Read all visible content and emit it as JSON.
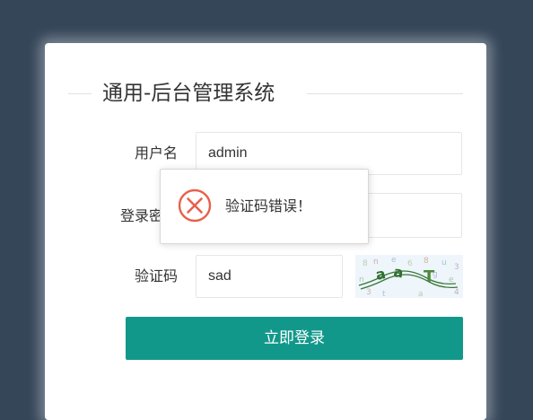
{
  "app": {
    "title": "通用-后台管理系统"
  },
  "form": {
    "username_label": "用户名",
    "username_value": "admin",
    "password_label": "登录密码",
    "password_value": "",
    "captcha_label": "验证码",
    "captcha_value": "sad",
    "submit_label": "立即登录"
  },
  "toast": {
    "message": "验证码错误！",
    "icon": "error-circle-x-icon"
  },
  "colors": {
    "background": "#354659",
    "card": "#ffffff",
    "primary_button": "#12988a",
    "error_icon": "#e8604c"
  }
}
